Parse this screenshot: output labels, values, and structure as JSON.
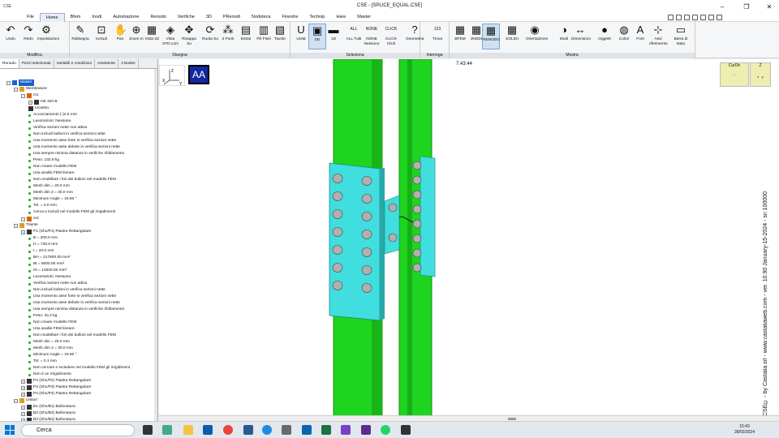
{
  "window": {
    "title": "CSE - [SPLICE_EQUAL.CSE]",
    "logo": "CSE"
  },
  "menu": [
    "File",
    "Home",
    "Bfem",
    "Inodi",
    "Automazione",
    "Renodo",
    "Verifiche",
    "3D",
    "PRenodi",
    "Nodoteca",
    "Finestre",
    "Technip",
    "Hare",
    "Master"
  ],
  "ribbon": {
    "groups": [
      "Modifica",
      "Disegna",
      "Seleziona",
      "Interroga",
      "Mostra"
    ],
    "buttons": [
      {
        "label": "Undo",
        "icon": "↶"
      },
      {
        "label": "Redo",
        "icon": "↷"
      },
      {
        "label": "Impostazioni",
        "icon": "⚙"
      },
      {
        "label": "Ridisegna",
        "icon": "✎"
      },
      {
        "label": "Includi",
        "icon": "⊡"
      },
      {
        "label": "Pan",
        "icon": "✋"
      },
      {
        "label": "Zoom In",
        "icon": "⊕"
      },
      {
        "label": "Vista 3d",
        "icon": "▦"
      },
      {
        "label": "Vista STD.com",
        "icon": "◈"
      },
      {
        "label": "Rinappa Su",
        "icon": "✥"
      },
      {
        "label": "Ruota Su",
        "icon": "⟳"
      },
      {
        "label": "3 Punti",
        "icon": "⁂"
      },
      {
        "label": "Estrai",
        "icon": "▤"
      },
      {
        "label": "Fili Fissi",
        "icon": "▥"
      },
      {
        "label": "Tavole",
        "icon": "▧"
      },
      {
        "label": "Unità",
        "icon": "U"
      },
      {
        "label": "0D",
        "icon": "▣"
      },
      {
        "label": "1D",
        "icon": "▬"
      },
      {
        "label": "ALL Tutti",
        "icon": "ALL"
      },
      {
        "label": "NONE Nessuno",
        "icon": "NONE"
      },
      {
        "label": "CLICK Click",
        "icon": "CLICK"
      },
      {
        "label": "Geometria",
        "icon": "?"
      },
      {
        "label": "Trova",
        "icon": "123"
      },
      {
        "label": "BFEM",
        "icon": "▦"
      },
      {
        "label": "JNODI",
        "icon": "▦"
      },
      {
        "label": "RENODO",
        "icon": "▦"
      },
      {
        "label": "SOLIDI",
        "icon": "▦"
      },
      {
        "label": "Orientazione",
        "icon": "◉"
      },
      {
        "label": "Modi",
        "icon": "◑"
      },
      {
        "label": "Dimensioni",
        "icon": "↔"
      },
      {
        "label": "Oggetti",
        "icon": "●"
      },
      {
        "label": "Colori",
        "icon": "◍"
      },
      {
        "label": "Font",
        "icon": "A"
      },
      {
        "label": "Assi riferimento",
        "icon": "⊹"
      },
      {
        "label": "Barra di stato",
        "icon": "▭"
      }
    ]
  },
  "left_tabs": [
    "Renodo",
    "Pezzi selezionati",
    "Variabili e condizioni",
    "Assistente",
    "J.Nodes"
  ],
  "tree": [
    {
      "d": 0,
      "t": "Master",
      "k": "root"
    },
    {
      "d": 1,
      "t": "Membrature",
      "k": "folder"
    },
    {
      "d": 2,
      "t": "m1",
      "k": "member"
    },
    {
      "d": 3,
      "t": "HE 320 B",
      "k": "section"
    },
    {
      "d": 3,
      "t": "Incastro",
      "k": "item"
    },
    {
      "d": 3,
      "t": "Accorciamento (-)2.5  mm",
      "k": "prop"
    },
    {
      "d": 3,
      "t": "Lavorazioni: Nessuna",
      "k": "prop"
    },
    {
      "d": 3,
      "t": "Verifica sezioni nette non attiva",
      "k": "prop"
    },
    {
      "d": 3,
      "t": "Non includi bulloni in verifica sezioni nette",
      "k": "prop"
    },
    {
      "d": 3,
      "t": "Usa momento asse forte in verifica sezioni nette",
      "k": "prop"
    },
    {
      "d": 3,
      "t": "Usa momento asse debole in verifica sezioni nette",
      "k": "prop"
    },
    {
      "d": 3,
      "t": "Usa sempre minima distanza in verifiche rifollamento",
      "k": "prop"
    },
    {
      "d": 3,
      "t": "Peso:    132.9 kg",
      "k": "prop"
    },
    {
      "d": 3,
      "t": "Non creare modello FEM",
      "k": "prop"
    },
    {
      "d": 3,
      "t": "Usa analisi FEM lineare",
      "k": "prop"
    },
    {
      "d": 3,
      "t": "Non modellare i fori dei bulloni nel modello FEM",
      "k": "prop"
    },
    {
      "d": 3,
      "t": "Mesh dim =  20.0 mm",
      "k": "prop"
    },
    {
      "d": 3,
      "t": "Mesh dim 2 =  30.0 mm",
      "k": "prop"
    },
    {
      "d": 3,
      "t": "Minimum Angle = 19.80 °",
      "k": "prop"
    },
    {
      "d": 3,
      "t": "Tol. =  0.0 mm",
      "k": "prop"
    },
    {
      "d": 3,
      "t": "Cerca e includi nel modello FEM gli irrigidimenti",
      "k": "prop"
    },
    {
      "d": 2,
      "t": "m2",
      "k": "member"
    },
    {
      "d": 1,
      "t": "Trainte",
      "k": "folder"
    },
    {
      "d": 2,
      "t": "P1 (Sh1/P1)  Piastra Rettangolare",
      "k": "plate"
    },
    {
      "d": 3,
      "t": "B = 300.0 mm",
      "k": "prop"
    },
    {
      "d": 3,
      "t": "H = 726.0 mm",
      "k": "prop"
    },
    {
      "d": 3,
      "t": "t = 20.0 mm",
      "k": "prop"
    },
    {
      "d": 3,
      "t": "BH = 217800.00 mm²",
      "k": "prop"
    },
    {
      "d": 3,
      "t": "Bt = 6000.00 mm²",
      "k": "prop"
    },
    {
      "d": 3,
      "t": "Ht = 14520.00 mm²",
      "k": "prop"
    },
    {
      "d": 3,
      "t": "Lavorazioni: Nessuna",
      "k": "prop"
    },
    {
      "d": 3,
      "t": "Verifica sezioni nette non attiva",
      "k": "prop"
    },
    {
      "d": 3,
      "t": "Non includi bulloni in verifica sezioni nette",
      "k": "prop"
    },
    {
      "d": 3,
      "t": "Usa momento asse forte in verifica sezioni nette",
      "k": "prop"
    },
    {
      "d": 3,
      "t": "Usa momento asse debole in verifica sezioni nette",
      "k": "prop"
    },
    {
      "d": 3,
      "t": "Usa sempre minima distanza in verifiche rifollamento",
      "k": "prop"
    },
    {
      "d": 3,
      "t": "Peso:    34.2 kg",
      "k": "prop"
    },
    {
      "d": 3,
      "t": "Non creare modello FEM",
      "k": "prop"
    },
    {
      "d": 3,
      "t": "Usa analisi FEM lineare",
      "k": "prop"
    },
    {
      "d": 3,
      "t": "Non modellare i fori dei bulloni nel modello FEM",
      "k": "prop"
    },
    {
      "d": 3,
      "t": "Mesh dim =  20.0 mm",
      "k": "prop"
    },
    {
      "d": 3,
      "t": "Mesh dim 2 =  30.0 mm",
      "k": "prop"
    },
    {
      "d": 3,
      "t": "Minimum Angle = 19.80 °",
      "k": "prop"
    },
    {
      "d": 3,
      "t": "Tol. =  0.1 mm",
      "k": "prop"
    },
    {
      "d": 3,
      "t": "Non cercare e includere nel modello FEM gli irrigidiment",
      "k": "prop"
    },
    {
      "d": 3,
      "t": "Non è un irrigidimento",
      "k": "prop"
    },
    {
      "d": 2,
      "t": "P2 (Sh1/P2)  Piastra Rettangolare",
      "k": "plate"
    },
    {
      "d": 2,
      "t": "P3 (Sh1/P3)  Piastra Rettangolare",
      "k": "plate"
    },
    {
      "d": 2,
      "t": "P4 (Sh1/P4)  Piastra Rettangolare",
      "k": "plate"
    },
    {
      "d": 1,
      "t": "Unitori",
      "k": "folder"
    },
    {
      "d": 2,
      "t": "B1 (Sh1/B1)  Bullonatura",
      "k": "bolt"
    },
    {
      "d": 2,
      "t": "B2 (Sh1/B2)  Bullonatura",
      "k": "bolt"
    },
    {
      "d": 2,
      "t": "B3 (Sh1/B3)  Bullonatura",
      "k": "bolt"
    }
  ],
  "view": {
    "time": "7:43:44",
    "aa_label": "AA",
    "curdir_label": "CurDir",
    "axis_z": "Z",
    "axis_x": "X",
    "axis_y": "Y",
    "vertical_text": "CSE© - by Castalia srl - www.castaliaweb.com - ver. 10.90 January-15-2024 - sn 100000"
  },
  "taskbar": {
    "search": "Cerca",
    "time": "15:43",
    "date": "28/02/2024"
  },
  "colors": {
    "steel": "#1fd41f",
    "steel_dark": "#129612",
    "plate": "#40dede",
    "bolt": "#b0b0b0",
    "aa_bg": "#1428a0"
  }
}
